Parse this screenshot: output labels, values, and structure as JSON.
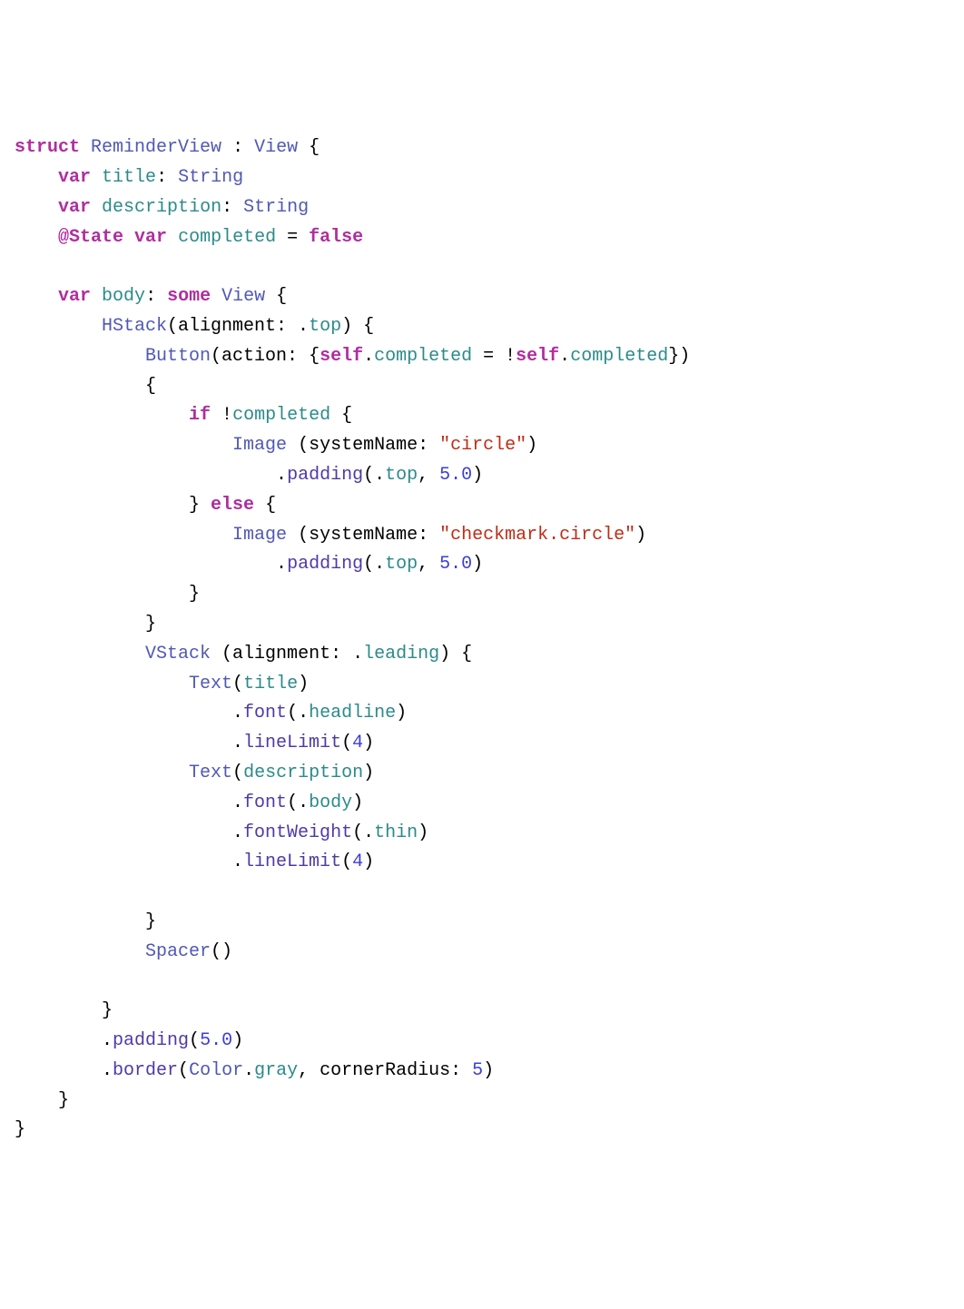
{
  "code": {
    "tokens": [
      [
        {
          "t": "struct",
          "c": "kw"
        },
        {
          "t": " ",
          "c": "plain"
        },
        {
          "t": "ReminderView",
          "c": "type"
        },
        {
          "t": " : ",
          "c": "plain"
        },
        {
          "t": "View",
          "c": "type"
        },
        {
          "t": " {",
          "c": "plain"
        }
      ],
      [
        {
          "t": "    ",
          "c": "plain"
        },
        {
          "t": "var",
          "c": "kw"
        },
        {
          "t": " ",
          "c": "plain"
        },
        {
          "t": "title",
          "c": "prop"
        },
        {
          "t": ": ",
          "c": "plain"
        },
        {
          "t": "String",
          "c": "type"
        }
      ],
      [
        {
          "t": "    ",
          "c": "plain"
        },
        {
          "t": "var",
          "c": "kw"
        },
        {
          "t": " ",
          "c": "plain"
        },
        {
          "t": "description",
          "c": "prop"
        },
        {
          "t": ": ",
          "c": "plain"
        },
        {
          "t": "String",
          "c": "type"
        }
      ],
      [
        {
          "t": "    ",
          "c": "plain"
        },
        {
          "t": "@State",
          "c": "attr"
        },
        {
          "t": " ",
          "c": "plain"
        },
        {
          "t": "var",
          "c": "kw"
        },
        {
          "t": " ",
          "c": "plain"
        },
        {
          "t": "completed",
          "c": "prop"
        },
        {
          "t": " = ",
          "c": "plain"
        },
        {
          "t": "false",
          "c": "boolkw"
        }
      ],
      [
        {
          "t": "",
          "c": "plain"
        }
      ],
      [
        {
          "t": "    ",
          "c": "plain"
        },
        {
          "t": "var",
          "c": "kw"
        },
        {
          "t": " ",
          "c": "plain"
        },
        {
          "t": "body",
          "c": "prop"
        },
        {
          "t": ": ",
          "c": "plain"
        },
        {
          "t": "some",
          "c": "kw"
        },
        {
          "t": " ",
          "c": "plain"
        },
        {
          "t": "View",
          "c": "type"
        },
        {
          "t": " {",
          "c": "plain"
        }
      ],
      [
        {
          "t": "        ",
          "c": "plain"
        },
        {
          "t": "HStack",
          "c": "type"
        },
        {
          "t": "(alignment: .",
          "c": "plain"
        },
        {
          "t": "top",
          "c": "enumcase"
        },
        {
          "t": ") {",
          "c": "plain"
        }
      ],
      [
        {
          "t": "            ",
          "c": "plain"
        },
        {
          "t": "Button",
          "c": "type"
        },
        {
          "t": "(action: {",
          "c": "plain"
        },
        {
          "t": "self",
          "c": "kw"
        },
        {
          "t": ".",
          "c": "plain"
        },
        {
          "t": "completed",
          "c": "prop"
        },
        {
          "t": " = !",
          "c": "plain"
        },
        {
          "t": "self",
          "c": "kw"
        },
        {
          "t": ".",
          "c": "plain"
        },
        {
          "t": "completed",
          "c": "prop"
        },
        {
          "t": "})",
          "c": "plain"
        }
      ],
      [
        {
          "t": "            {",
          "c": "plain"
        }
      ],
      [
        {
          "t": "                ",
          "c": "plain"
        },
        {
          "t": "if",
          "c": "kw"
        },
        {
          "t": " !",
          "c": "plain"
        },
        {
          "t": "completed",
          "c": "prop"
        },
        {
          "t": " {",
          "c": "plain"
        }
      ],
      [
        {
          "t": "                    ",
          "c": "plain"
        },
        {
          "t": "Image",
          "c": "type"
        },
        {
          "t": " (systemName: ",
          "c": "plain"
        },
        {
          "t": "\"circle\"",
          "c": "str"
        },
        {
          "t": ")",
          "c": "plain"
        }
      ],
      [
        {
          "t": "                        .",
          "c": "plain"
        },
        {
          "t": "padding",
          "c": "func"
        },
        {
          "t": "(.",
          "c": "plain"
        },
        {
          "t": "top",
          "c": "enumcase"
        },
        {
          "t": ", ",
          "c": "plain"
        },
        {
          "t": "5.0",
          "c": "num"
        },
        {
          "t": ")",
          "c": "plain"
        }
      ],
      [
        {
          "t": "                } ",
          "c": "plain"
        },
        {
          "t": "else",
          "c": "kw"
        },
        {
          "t": " {",
          "c": "plain"
        }
      ],
      [
        {
          "t": "                    ",
          "c": "plain"
        },
        {
          "t": "Image",
          "c": "type"
        },
        {
          "t": " (systemName: ",
          "c": "plain"
        },
        {
          "t": "\"checkmark.circle\"",
          "c": "str"
        },
        {
          "t": ")",
          "c": "plain"
        }
      ],
      [
        {
          "t": "                        .",
          "c": "plain"
        },
        {
          "t": "padding",
          "c": "func"
        },
        {
          "t": "(.",
          "c": "plain"
        },
        {
          "t": "top",
          "c": "enumcase"
        },
        {
          "t": ", ",
          "c": "plain"
        },
        {
          "t": "5.0",
          "c": "num"
        },
        {
          "t": ")",
          "c": "plain"
        }
      ],
      [
        {
          "t": "                }",
          "c": "plain"
        }
      ],
      [
        {
          "t": "            }",
          "c": "plain"
        }
      ],
      [
        {
          "t": "            ",
          "c": "plain"
        },
        {
          "t": "VStack",
          "c": "type"
        },
        {
          "t": " (alignment: .",
          "c": "plain"
        },
        {
          "t": "leading",
          "c": "enumcase"
        },
        {
          "t": ") {",
          "c": "plain"
        }
      ],
      [
        {
          "t": "                ",
          "c": "plain"
        },
        {
          "t": "Text",
          "c": "type"
        },
        {
          "t": "(",
          "c": "plain"
        },
        {
          "t": "title",
          "c": "prop"
        },
        {
          "t": ")",
          "c": "plain"
        }
      ],
      [
        {
          "t": "                    .",
          "c": "plain"
        },
        {
          "t": "font",
          "c": "func"
        },
        {
          "t": "(.",
          "c": "plain"
        },
        {
          "t": "headline",
          "c": "enumcase"
        },
        {
          "t": ")",
          "c": "plain"
        }
      ],
      [
        {
          "t": "                    .",
          "c": "plain"
        },
        {
          "t": "lineLimit",
          "c": "func"
        },
        {
          "t": "(",
          "c": "plain"
        },
        {
          "t": "4",
          "c": "num"
        },
        {
          "t": ")",
          "c": "plain"
        }
      ],
      [
        {
          "t": "                ",
          "c": "plain"
        },
        {
          "t": "Text",
          "c": "type"
        },
        {
          "t": "(",
          "c": "plain"
        },
        {
          "t": "description",
          "c": "prop"
        },
        {
          "t": ")",
          "c": "plain"
        }
      ],
      [
        {
          "t": "                    .",
          "c": "plain"
        },
        {
          "t": "font",
          "c": "func"
        },
        {
          "t": "(.",
          "c": "plain"
        },
        {
          "t": "body",
          "c": "enumcase"
        },
        {
          "t": ")",
          "c": "plain"
        }
      ],
      [
        {
          "t": "                    .",
          "c": "plain"
        },
        {
          "t": "fontWeight",
          "c": "func"
        },
        {
          "t": "(.",
          "c": "plain"
        },
        {
          "t": "thin",
          "c": "enumcase"
        },
        {
          "t": ")",
          "c": "plain"
        }
      ],
      [
        {
          "t": "                    .",
          "c": "plain"
        },
        {
          "t": "lineLimit",
          "c": "func"
        },
        {
          "t": "(",
          "c": "plain"
        },
        {
          "t": "4",
          "c": "num"
        },
        {
          "t": ")",
          "c": "plain"
        }
      ],
      [
        {
          "t": "",
          "c": "plain"
        }
      ],
      [
        {
          "t": "            }",
          "c": "plain"
        }
      ],
      [
        {
          "t": "            ",
          "c": "plain"
        },
        {
          "t": "Spacer",
          "c": "type"
        },
        {
          "t": "()",
          "c": "plain"
        }
      ],
      [
        {
          "t": "",
          "c": "plain"
        }
      ],
      [
        {
          "t": "        }",
          "c": "plain"
        }
      ],
      [
        {
          "t": "        .",
          "c": "plain"
        },
        {
          "t": "padding",
          "c": "func"
        },
        {
          "t": "(",
          "c": "plain"
        },
        {
          "t": "5.0",
          "c": "num"
        },
        {
          "t": ")",
          "c": "plain"
        }
      ],
      [
        {
          "t": "        .",
          "c": "plain"
        },
        {
          "t": "border",
          "c": "func"
        },
        {
          "t": "(",
          "c": "plain"
        },
        {
          "t": "Color",
          "c": "type"
        },
        {
          "t": ".",
          "c": "plain"
        },
        {
          "t": "gray",
          "c": "enumcase"
        },
        {
          "t": ", cornerRadius: ",
          "c": "plain"
        },
        {
          "t": "5",
          "c": "num"
        },
        {
          "t": ")",
          "c": "plain"
        }
      ],
      [
        {
          "t": "    }",
          "c": "plain"
        }
      ],
      [
        {
          "t": "}",
          "c": "plain"
        }
      ]
    ]
  }
}
